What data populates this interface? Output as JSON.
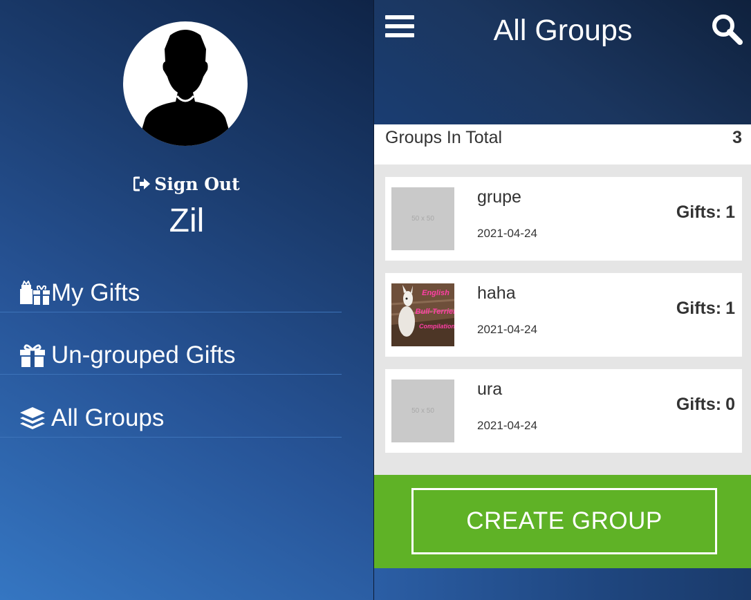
{
  "sidebar": {
    "sign_out_label": "Sign Out",
    "username": "Zil",
    "menu": [
      {
        "label": "My Gifts",
        "icon": "gifts-icon"
      },
      {
        "label": "Un-grouped Gifts",
        "icon": "gift-icon"
      },
      {
        "label": "All Groups",
        "icon": "layers-icon"
      }
    ]
  },
  "header": {
    "title": "All Groups",
    "menu_icon": "hamburger-icon",
    "search_icon": "search-icon"
  },
  "summary": {
    "label": "Groups In Total",
    "count": "3"
  },
  "groups": [
    {
      "name": "grupe",
      "date": "2021-04-24",
      "gifts_label": "Gifts:",
      "gifts": "1",
      "thumb_text": "50 x 50"
    },
    {
      "name": "haha",
      "date": "2021-04-24",
      "gifts_label": "Gifts:",
      "gifts": "1",
      "thumb_text": "English Bull-Terrier Compilation"
    },
    {
      "name": "ura",
      "date": "2021-04-24",
      "gifts_label": "Gifts:",
      "gifts": "0",
      "thumb_text": "50 x 50"
    }
  ],
  "actions": {
    "create_group_label": "CREATE GROUP"
  },
  "colors": {
    "accent_green": "#5fb226",
    "header_navy": "#1b365f",
    "sidebar_blue": "#275497"
  }
}
